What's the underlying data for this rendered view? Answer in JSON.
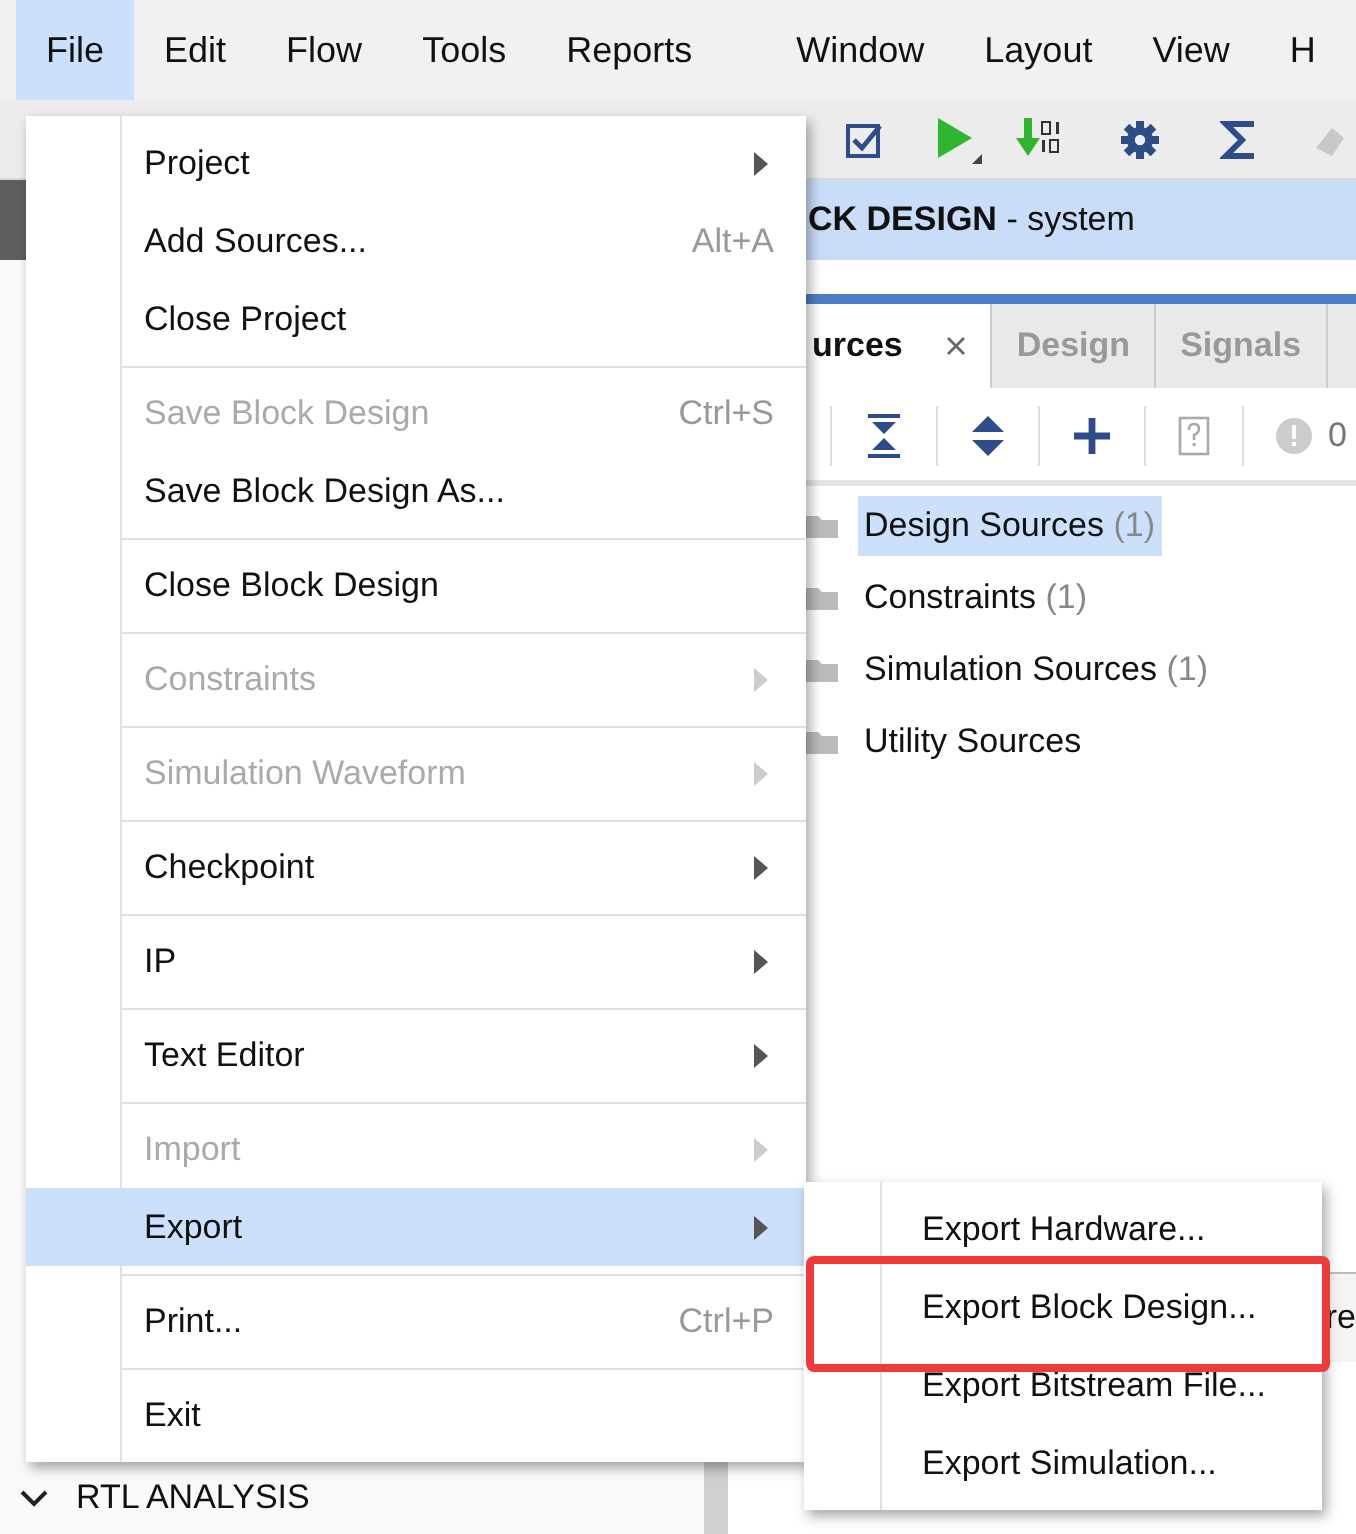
{
  "menubar": [
    {
      "label": "File",
      "selected": true
    },
    {
      "label": "Edit",
      "selected": false
    },
    {
      "label": "Flow",
      "selected": false
    },
    {
      "label": "Tools",
      "selected": false
    },
    {
      "label": "Reports",
      "selected": false
    },
    {
      "label": "Window",
      "selected": false
    },
    {
      "label": "Layout",
      "selected": false
    },
    {
      "label": "View",
      "selected": false
    },
    {
      "label": "H",
      "selected": false
    }
  ],
  "diagram_header": {
    "title": "**CK DESIGN** - system"
  },
  "sources_tabs": [
    {
      "label": "urces",
      "selected": true,
      "closable": true
    },
    {
      "label": "Design",
      "selected": false,
      "closable": false
    },
    {
      "label": "Signals",
      "selected": false,
      "closable": false
    }
  ],
  "sources_toolbar": {
    "count": "0"
  },
  "source_tree": [
    {
      "label": "Design Sources",
      "count": "(1)",
      "selected": true
    },
    {
      "label": "Constraints",
      "count": "(1)",
      "selected": false
    },
    {
      "label": "Simulation Sources",
      "count": "(1)",
      "selected": false
    },
    {
      "label": "Utility Sources",
      "selected": false
    }
  ],
  "lower_panel": {
    "tab_fragment": "re"
  },
  "left_panel": {
    "section": "RTL ANALYSIS",
    "expanded": true
  },
  "file_menu": [
    [
      {
        "label": "Project",
        "submenu": true,
        "disabled": false,
        "selected": false
      },
      {
        "label": "Add Sources...",
        "shortcut": "Alt+A",
        "submenu": false,
        "disabled": false,
        "selected": false
      },
      {
        "label": "Close Project",
        "submenu": false,
        "disabled": false,
        "selected": false
      }
    ],
    [
      {
        "label": "Save Block Design",
        "shortcut": "Ctrl+S",
        "submenu": false,
        "disabled": true,
        "selected": false
      },
      {
        "label": "Save Block Design As...",
        "submenu": false,
        "disabled": false,
        "selected": false
      }
    ],
    [
      {
        "label": "Close Block Design",
        "submenu": false,
        "disabled": false,
        "selected": false
      }
    ],
    [
      {
        "label": "Constraints",
        "submenu": true,
        "disabled": true,
        "selected": false
      }
    ],
    [
      {
        "label": "Simulation Waveform",
        "submenu": true,
        "disabled": true,
        "selected": false
      }
    ],
    [
      {
        "label": "Checkpoint",
        "submenu": true,
        "disabled": false,
        "selected": false
      }
    ],
    [
      {
        "label": "IP",
        "submenu": true,
        "disabled": false,
        "selected": false
      }
    ],
    [
      {
        "label": "Text Editor",
        "submenu": true,
        "disabled": false,
        "selected": false
      }
    ],
    [
      {
        "label": "Import",
        "submenu": true,
        "disabled": true,
        "selected": false
      },
      {
        "label": "Export",
        "submenu": true,
        "disabled": false,
        "selected": true
      }
    ],
    [
      {
        "label": "Print...",
        "shortcut": "Ctrl+P",
        "submenu": false,
        "disabled": false,
        "selected": false
      }
    ],
    [
      {
        "label": "Exit",
        "submenu": false,
        "disabled": false,
        "selected": false
      }
    ]
  ],
  "export_submenu": [
    {
      "label": "Export Hardware...",
      "annotated": false
    },
    {
      "label": "Export Block Design...",
      "annotated": true
    },
    {
      "label": "Export Bitstream File...",
      "annotated": false
    },
    {
      "label": "Export Simulation...",
      "annotated": false
    }
  ]
}
